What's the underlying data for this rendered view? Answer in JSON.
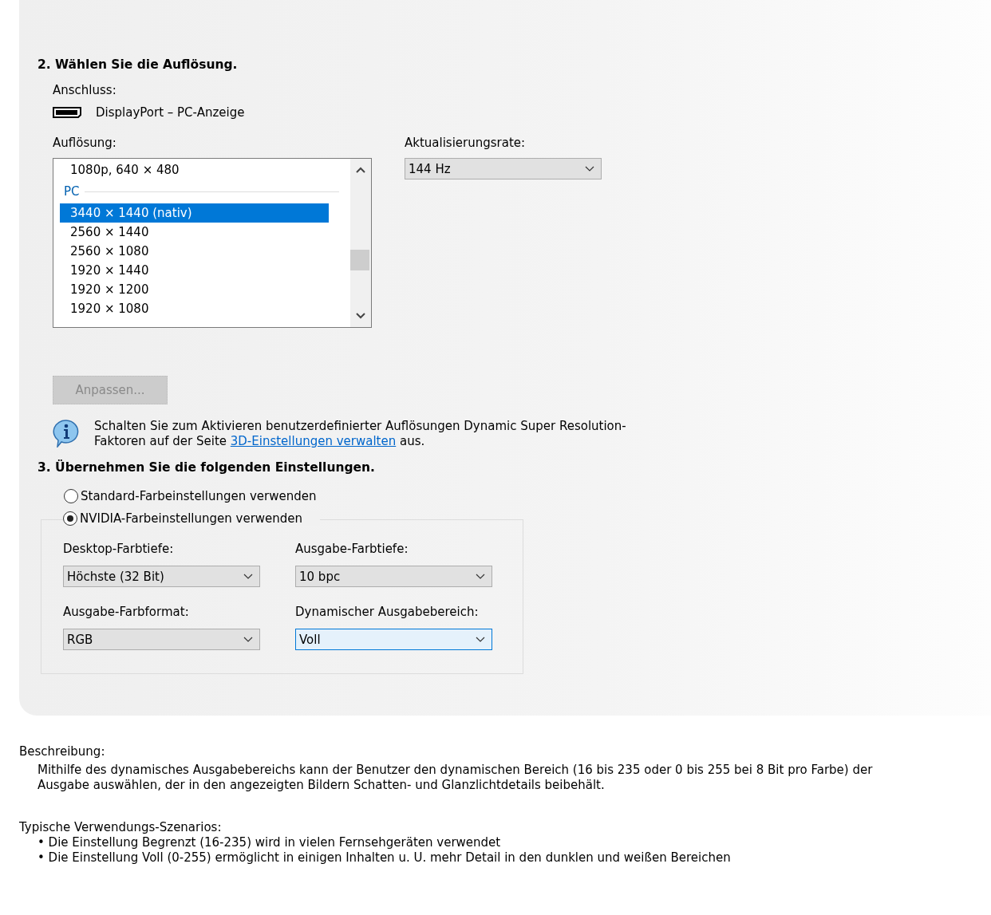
{
  "resolution_section": {
    "heading": "2. Wählen Sie die Auflösung.",
    "connection_label": "Anschluss:",
    "connection": "DisplayPort – PC-Anzeige",
    "resolution_label": "Auflösung:",
    "resolution_list": [
      {
        "kind": "item",
        "label": "1080p, 640 × 480",
        "selected": false
      },
      {
        "kind": "group",
        "label": "PC",
        "selected": false
      },
      {
        "kind": "item",
        "label": "3440 × 1440 (nativ)",
        "selected": true
      },
      {
        "kind": "item",
        "label": "2560 × 1440",
        "selected": false
      },
      {
        "kind": "item",
        "label": "2560 × 1080",
        "selected": false
      },
      {
        "kind": "item",
        "label": "1920 × 1440",
        "selected": false
      },
      {
        "kind": "item",
        "label": "1920 × 1200",
        "selected": false
      },
      {
        "kind": "item",
        "label": "1920 × 1080",
        "selected": false
      }
    ],
    "refresh_label": "Aktualisierungsrate:",
    "refresh_dropdown": {
      "value": "144 Hz",
      "focused": false
    },
    "customize_button": {
      "label": "Anpassen...",
      "disabled": true
    },
    "info": {
      "text_before": "Schalten Sie zum Aktivieren benutzerdefinierter Auflösungen Dynamic Super Resolution-Faktoren auf der Seite ",
      "link": "3D-Einstellungen verwalten",
      "text_after": " aus."
    }
  },
  "color_section": {
    "heading": "3. Übernehmen Sie die folgenden Einstellungen.",
    "radios": [
      {
        "label": "Standard-Farbeinstellungen verwenden",
        "selected": false
      },
      {
        "label": "NVIDIA-Farbeinstellungen verwenden",
        "selected": true
      }
    ],
    "fields": [
      {
        "label": "Desktop-Farbtiefe:",
        "value": "Höchste (32 Bit)",
        "focused": false
      },
      {
        "label": "Ausgabe-Farbtiefe:",
        "value": "10 bpc",
        "focused": false
      },
      {
        "label": "Ausgabe-Farbformat:",
        "value": "RGB",
        "focused": false
      },
      {
        "label": "Dynamischer Ausgabebereich:",
        "value": "Voll",
        "focused": true
      }
    ]
  },
  "description": {
    "label": "Beschreibung:",
    "text": "Mithilfe des dynamisches Ausgabebereichs kann der Benutzer den dynamischen Bereich (16 bis 235 oder 0 bis 255 bei 8 Bit pro Farbe) der Ausgabe auswählen, der in den angezeigten Bildern Schatten- und Glanzlichtdetails beibehält."
  },
  "scenarios": {
    "label": "Typische Verwendungs-Szenarios:",
    "bullets": [
      "• Die Einstellung Begrenzt (16-235) wird in vielen Fernsehgeräten verwendet",
      "• Die Einstellung Voll (0-255) ermöglicht in einigen Inhalten u. U. mehr Detail in den dunklen und weißen Bereichen"
    ]
  }
}
